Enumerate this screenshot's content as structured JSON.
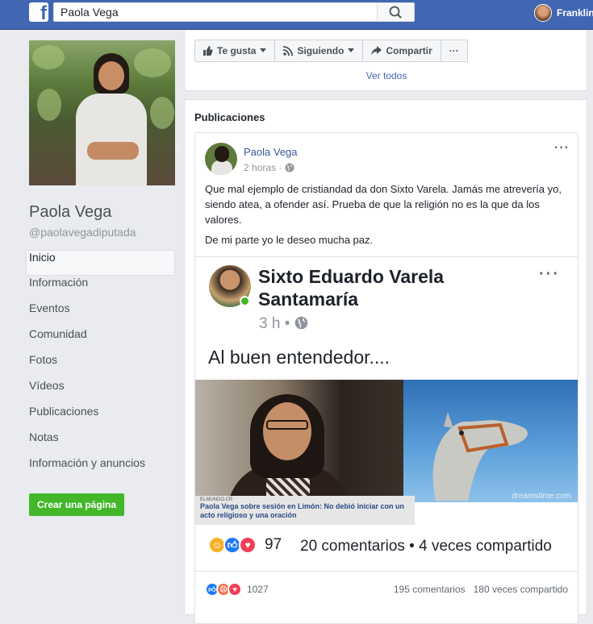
{
  "topbar": {
    "logo_letter": "f",
    "search_value": "Paola Vega",
    "user_name": "Franklin"
  },
  "profile": {
    "name": "Paola Vega",
    "handle": "@paolavegadiputada"
  },
  "nav": {
    "items": [
      "Inicio",
      "Información",
      "Eventos",
      "Comunidad",
      "Fotos",
      "Vídeos",
      "Publicaciones",
      "Notas",
      "Información y anuncios"
    ],
    "active": "Inicio"
  },
  "create_page_label": "Crear una página",
  "actions": {
    "like": "Te gusta",
    "following": "Siguiendo",
    "share": "Compartir",
    "more": "···"
  },
  "see_all": "Ver todos",
  "publications": {
    "title": "Publicaciones",
    "post": {
      "author": "Paola Vega",
      "time": "2 horas ·",
      "more": "···",
      "text1": "Que mal ejemplo de cristiandad da don Sixto Varela. Jamás me atrevería yo, siendo atea, a ofender así. Prueba de que la religión no es la que da los valores.",
      "text2": "De mi parte yo le deseo mucha paz.",
      "shared": {
        "author": "Sixto Eduardo Varela Santamaría",
        "time": "3 h •",
        "more": "···",
        "caption": "Al buen entendedor....",
        "news_source": "ELMUNDO.CR",
        "news_title": "Paola Vega sobre sesión en Limón: No debió iniciar con un acto religioso y una oración",
        "watermark": "dreamstime.com",
        "reaction_count": "97",
        "stats": "20 comentarios • 4 veces compartido"
      },
      "reaction_count": "1027",
      "comments": "195 comentarios",
      "shares": "180 veces compartido"
    }
  },
  "colors": {
    "brand": "#4267b2",
    "link": "#365899",
    "green": "#42b72a",
    "like": "#2078f4",
    "love": "#f33e58",
    "haha": "#f7b125"
  }
}
